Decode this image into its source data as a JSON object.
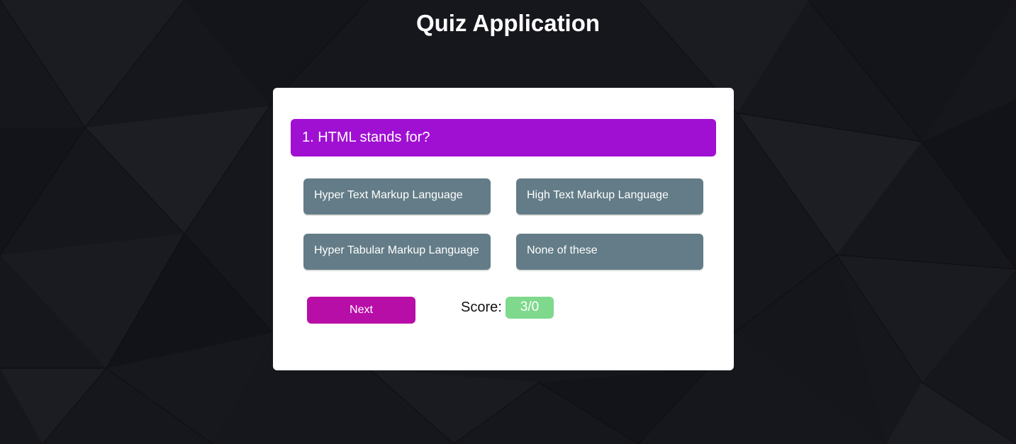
{
  "app": {
    "title": "Quiz Application"
  },
  "question": {
    "text": "1. HTML stands for?"
  },
  "options": [
    {
      "label": "Hyper Text Markup Language"
    },
    {
      "label": "High Text Markup Language"
    },
    {
      "label": "Hyper Tabular Markup Language"
    },
    {
      "label": "None of these"
    }
  ],
  "controls": {
    "next_label": "Next",
    "score_label": "Score:",
    "score_value": "3/0"
  },
  "colors": {
    "background": "#15161b",
    "question_bar": "#a010d2",
    "option": "#637c87",
    "next_button": "#b80ea8",
    "score_badge": "#7ed98c"
  }
}
